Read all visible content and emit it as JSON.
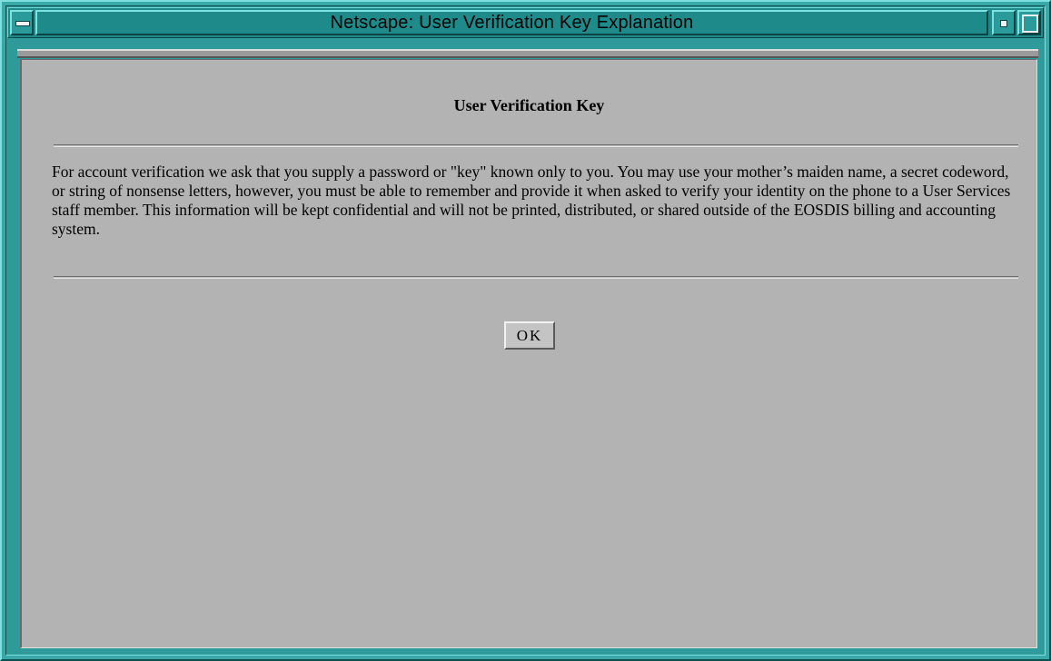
{
  "window": {
    "title": "Netscape: User Verification Key Explanation",
    "icons": {
      "menu": "window-menu-icon",
      "minimize": "minimize-icon",
      "maximize": "maximize-icon"
    },
    "colors": {
      "frame": "#3aa8a8",
      "titlebar": "#1e8a8a",
      "content_background": "#b3b3b3"
    }
  },
  "page": {
    "heading": "User Verification Key",
    "body": "For account verification we ask that you supply a password or \"key\" known only to you. You may use your mother’s maiden name, a secret codeword, or string of nonsense letters, however, you must be able to remember and provide it when asked to verify your identity on the phone to a User Services staff member. This information will be kept confidential and will not be printed, distributed, or shared outside of the EOSDIS billing and accounting system.",
    "ok_label": "OK"
  }
}
